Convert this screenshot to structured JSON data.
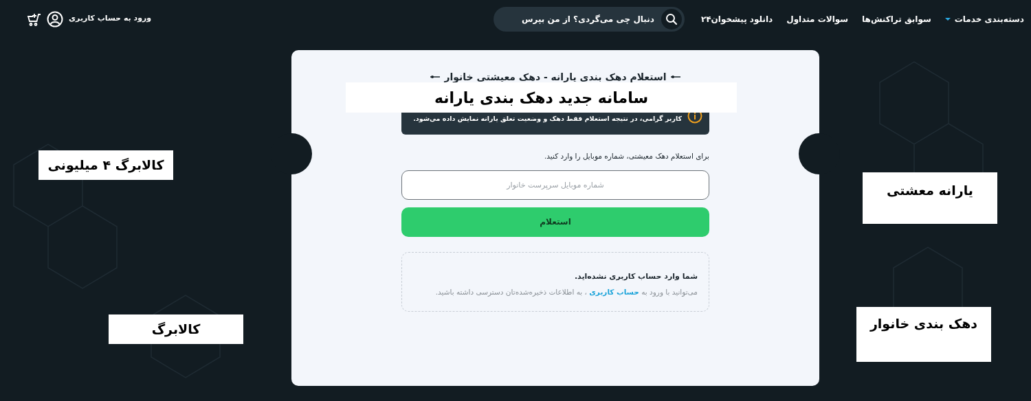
{
  "header": {
    "nav": [
      {
        "label": "دسته‌بندی خدمات",
        "kind": "dropdown"
      },
      {
        "label": "سوابق تراکنش‌ها",
        "kind": "link"
      },
      {
        "label": "سوالات متداول",
        "kind": "link"
      },
      {
        "label": "دانلود پیشخوان۲۴",
        "kind": "link"
      }
    ],
    "search": {
      "placeholder": "دنبال چی می‌گردی؟ از من بپرس"
    },
    "login": "ورود به حساب کاربری"
  },
  "card": {
    "title": "استعلام دهک بندی یارانه - دهک معیشتی خانوار",
    "notice": "کاربر گرامی، در نتیجه استعلام فقط دهک و وضعیت تعلق یارانه نمایش داده می‌شود.",
    "instruction": "برای استعلام دهک معیشتی، شماره موبایل را وارد کنید.",
    "phone_field": {
      "placeholder": "شماره موبایل سرپرست خانوار"
    },
    "submit": "استعلام",
    "login_notice": {
      "heading": "شما وارد حساب کاربری نشده‌اید.",
      "before": "می‌توانید با ورود به",
      "link": "حساب کاربری",
      "after": "، به اطلاعات ذخیره‌شده‌تان دسترسی داشته باشید."
    }
  },
  "overlay_labels": [
    {
      "text": "سامانه جدید دهک بندی یارانه"
    },
    {
      "text": "کالابرگ ۴ میلیونی"
    },
    {
      "text": "یارانه معشتی"
    },
    {
      "text": "کالابرگ"
    },
    {
      "text": "دهک بندی خانوار"
    }
  ]
}
